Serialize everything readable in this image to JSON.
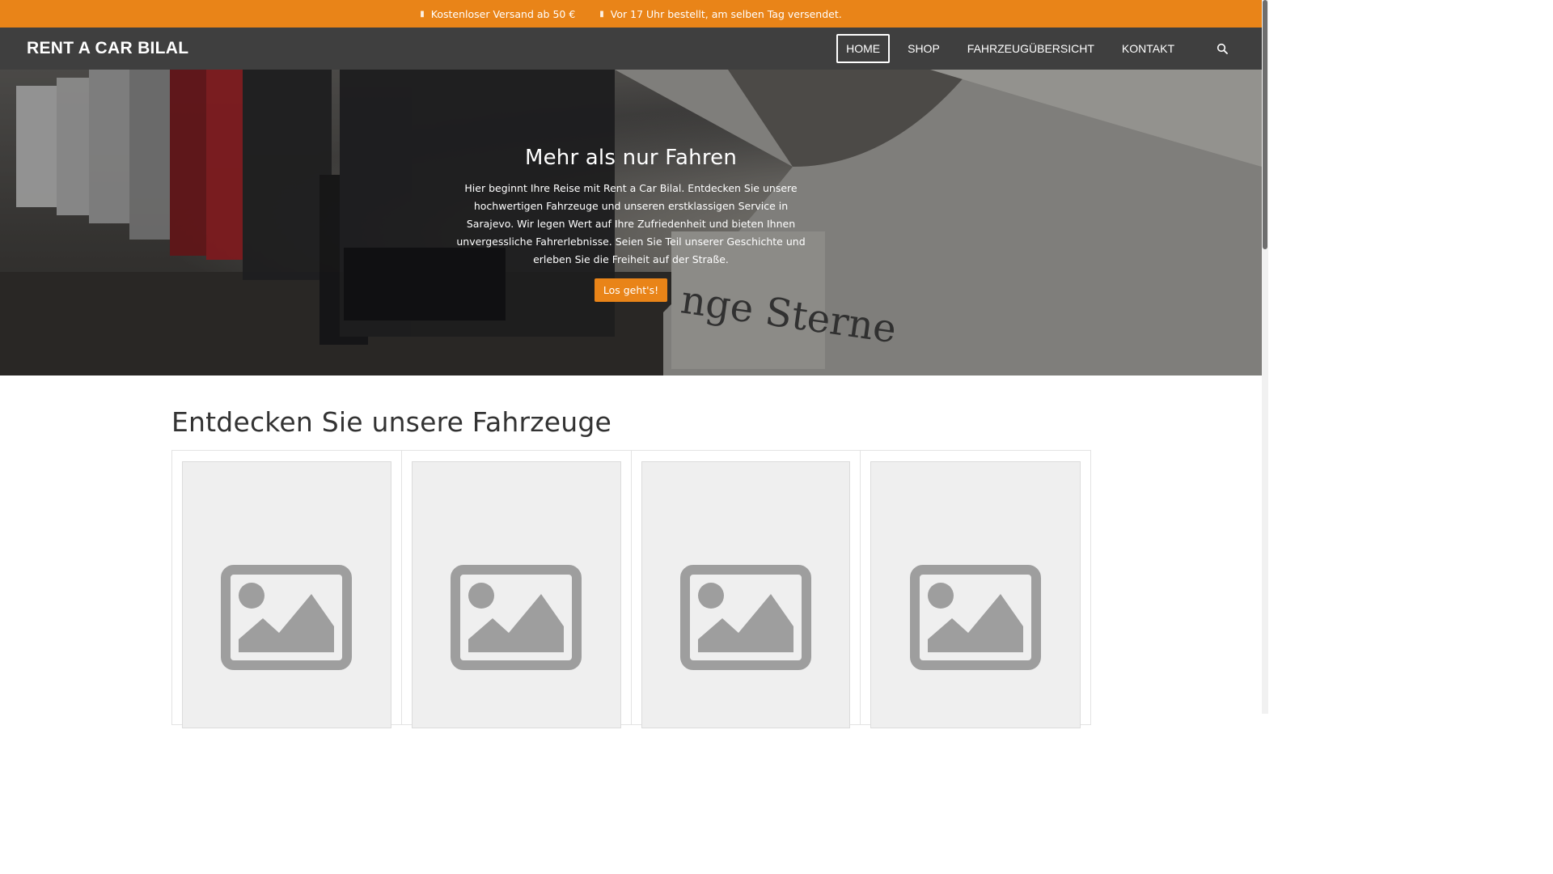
{
  "topbar": {
    "msg1": "Kostenloser Versand ab 50 €",
    "msg2": "Vor 17 Uhr bestellt, am selben Tag versendet.",
    "color": "#e98418"
  },
  "nav": {
    "brand": "RENT A CAR BILAL",
    "items": [
      {
        "label": "HOME",
        "active": true
      },
      {
        "label": "SHOP"
      },
      {
        "label": "FAHRZEUGÜBERSICHT"
      },
      {
        "label": "KONTAKT"
      }
    ],
    "search_icon": "search-icon"
  },
  "hero": {
    "title": "Mehr als nur Fahren",
    "text": "Hier beginnt Ihre Reise mit Rent a Car Bilal. Entdecken Sie unsere hochwertigen Fahrzeuge und unseren erstklassigen Service in Sarajevo. Wir legen Wert auf Ihre Zufriedenheit und bieten Ihnen unvergessliche Fahrerlebnisse. Seien Sie Teil unserer Geschichte und erleben Sie die Freiheit auf der Straße.",
    "button": "Los geht's!",
    "plate_text": "nge Sterne"
  },
  "products": {
    "title": "Entdecken Sie unsere Fahrzeuge",
    "placeholder_icon": "image-placeholder-icon"
  }
}
